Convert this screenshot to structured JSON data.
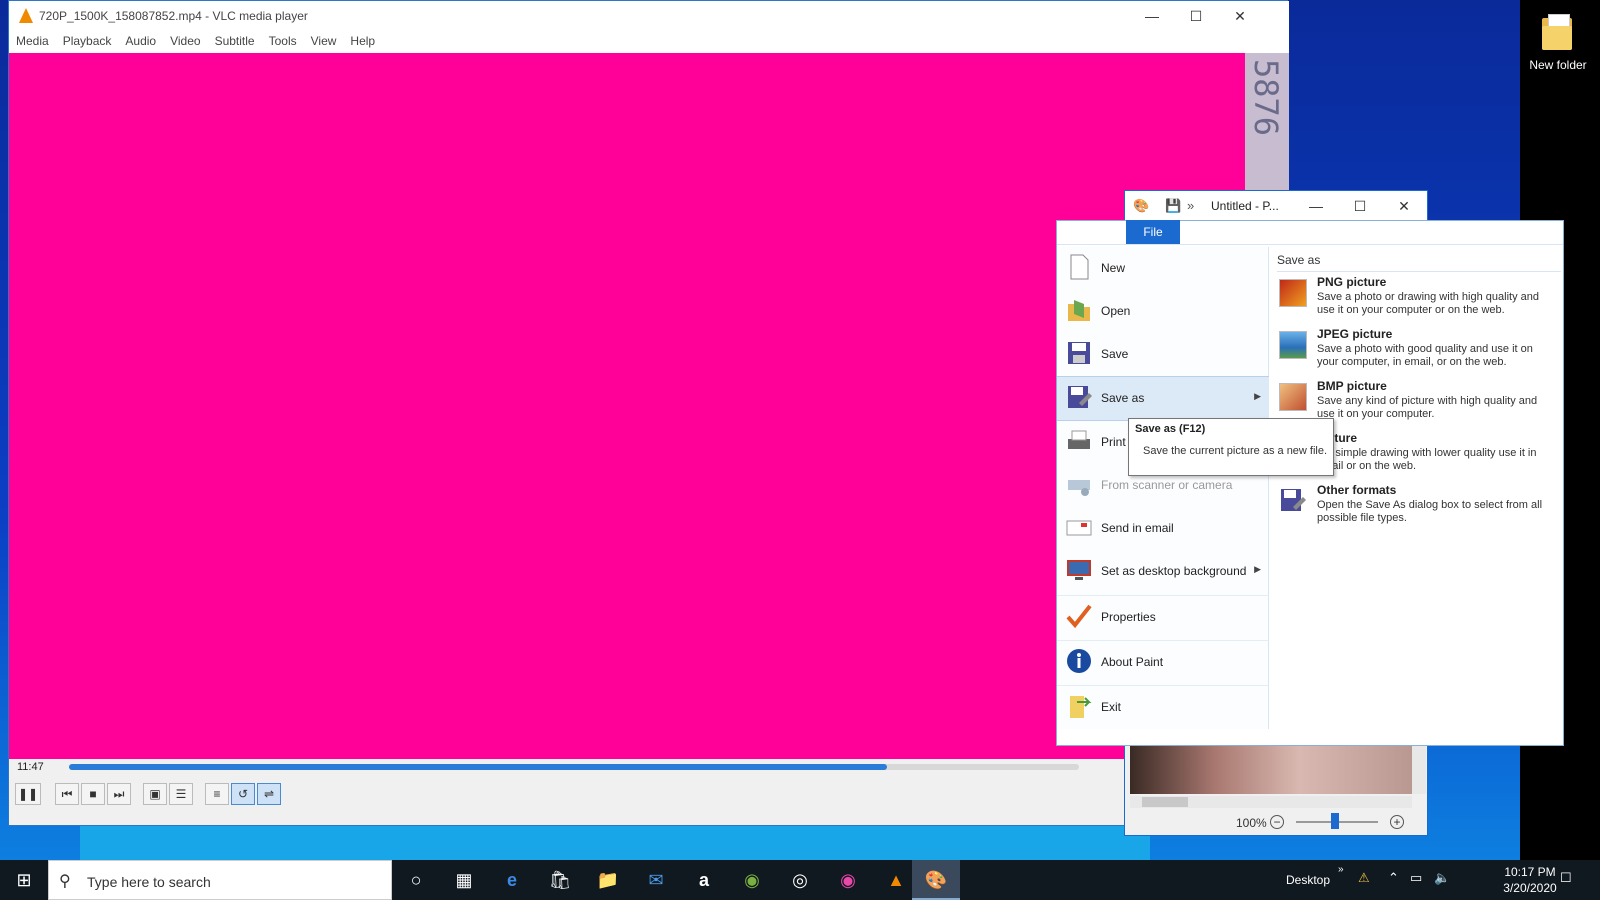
{
  "desktop": {
    "icon_label": "New folder"
  },
  "vlc": {
    "title": "720P_1500K_158087852.mp4 - VLC media player",
    "menu": [
      "Media",
      "Playback",
      "Audio",
      "Video",
      "Subtitle",
      "Tools",
      "View",
      "Help"
    ],
    "overlay_digits": "5876",
    "time": "11:47",
    "progress_fraction": 0.81,
    "video_color": "#ff0099"
  },
  "paint": {
    "title": "Untitled - P...",
    "file_tab": "File",
    "zoom": "100%",
    "menu_items": [
      {
        "label": "New",
        "icon": "new-file-icon"
      },
      {
        "label": "Open",
        "icon": "open-folder-icon"
      },
      {
        "label": "Save",
        "icon": "save-icon"
      },
      {
        "label": "Save as",
        "icon": "save-as-icon"
      },
      {
        "label": "Print",
        "icon": "printer-icon"
      },
      {
        "label": "From scanner or camera",
        "icon": "scanner-icon"
      },
      {
        "label": "Send in email",
        "icon": "email-icon"
      },
      {
        "label": "Set as desktop background",
        "icon": "desktop-background-icon"
      },
      {
        "label": "Properties",
        "icon": "checkmark-icon"
      },
      {
        "label": "About Paint",
        "icon": "info-icon"
      },
      {
        "label": "Exit",
        "icon": "exit-icon"
      }
    ],
    "save_as_header": "Save as",
    "formats": [
      {
        "title": "PNG picture",
        "desc": "Save a photo or drawing with high quality and use it on your computer or on the web."
      },
      {
        "title": "JPEG picture",
        "desc": "Save a photo with good quality and use it on your computer, in email, or on the web."
      },
      {
        "title": "BMP picture",
        "desc": "Save any kind of picture with high quality and use it on your computer."
      },
      {
        "title": "picture",
        "desc": "e a simple drawing with lower quality use it in email or on the web."
      },
      {
        "title": "Other formats",
        "desc": "Open the Save As dialog box to select from all possible file types."
      }
    ],
    "tooltip": {
      "title": "Save as (F12)",
      "desc": "Save the current picture as a new file."
    }
  },
  "taskbar": {
    "search_placeholder": "Type here to search",
    "desktop_label": "Desktop",
    "time": "10:17 PM",
    "date": "3/20/2020"
  }
}
